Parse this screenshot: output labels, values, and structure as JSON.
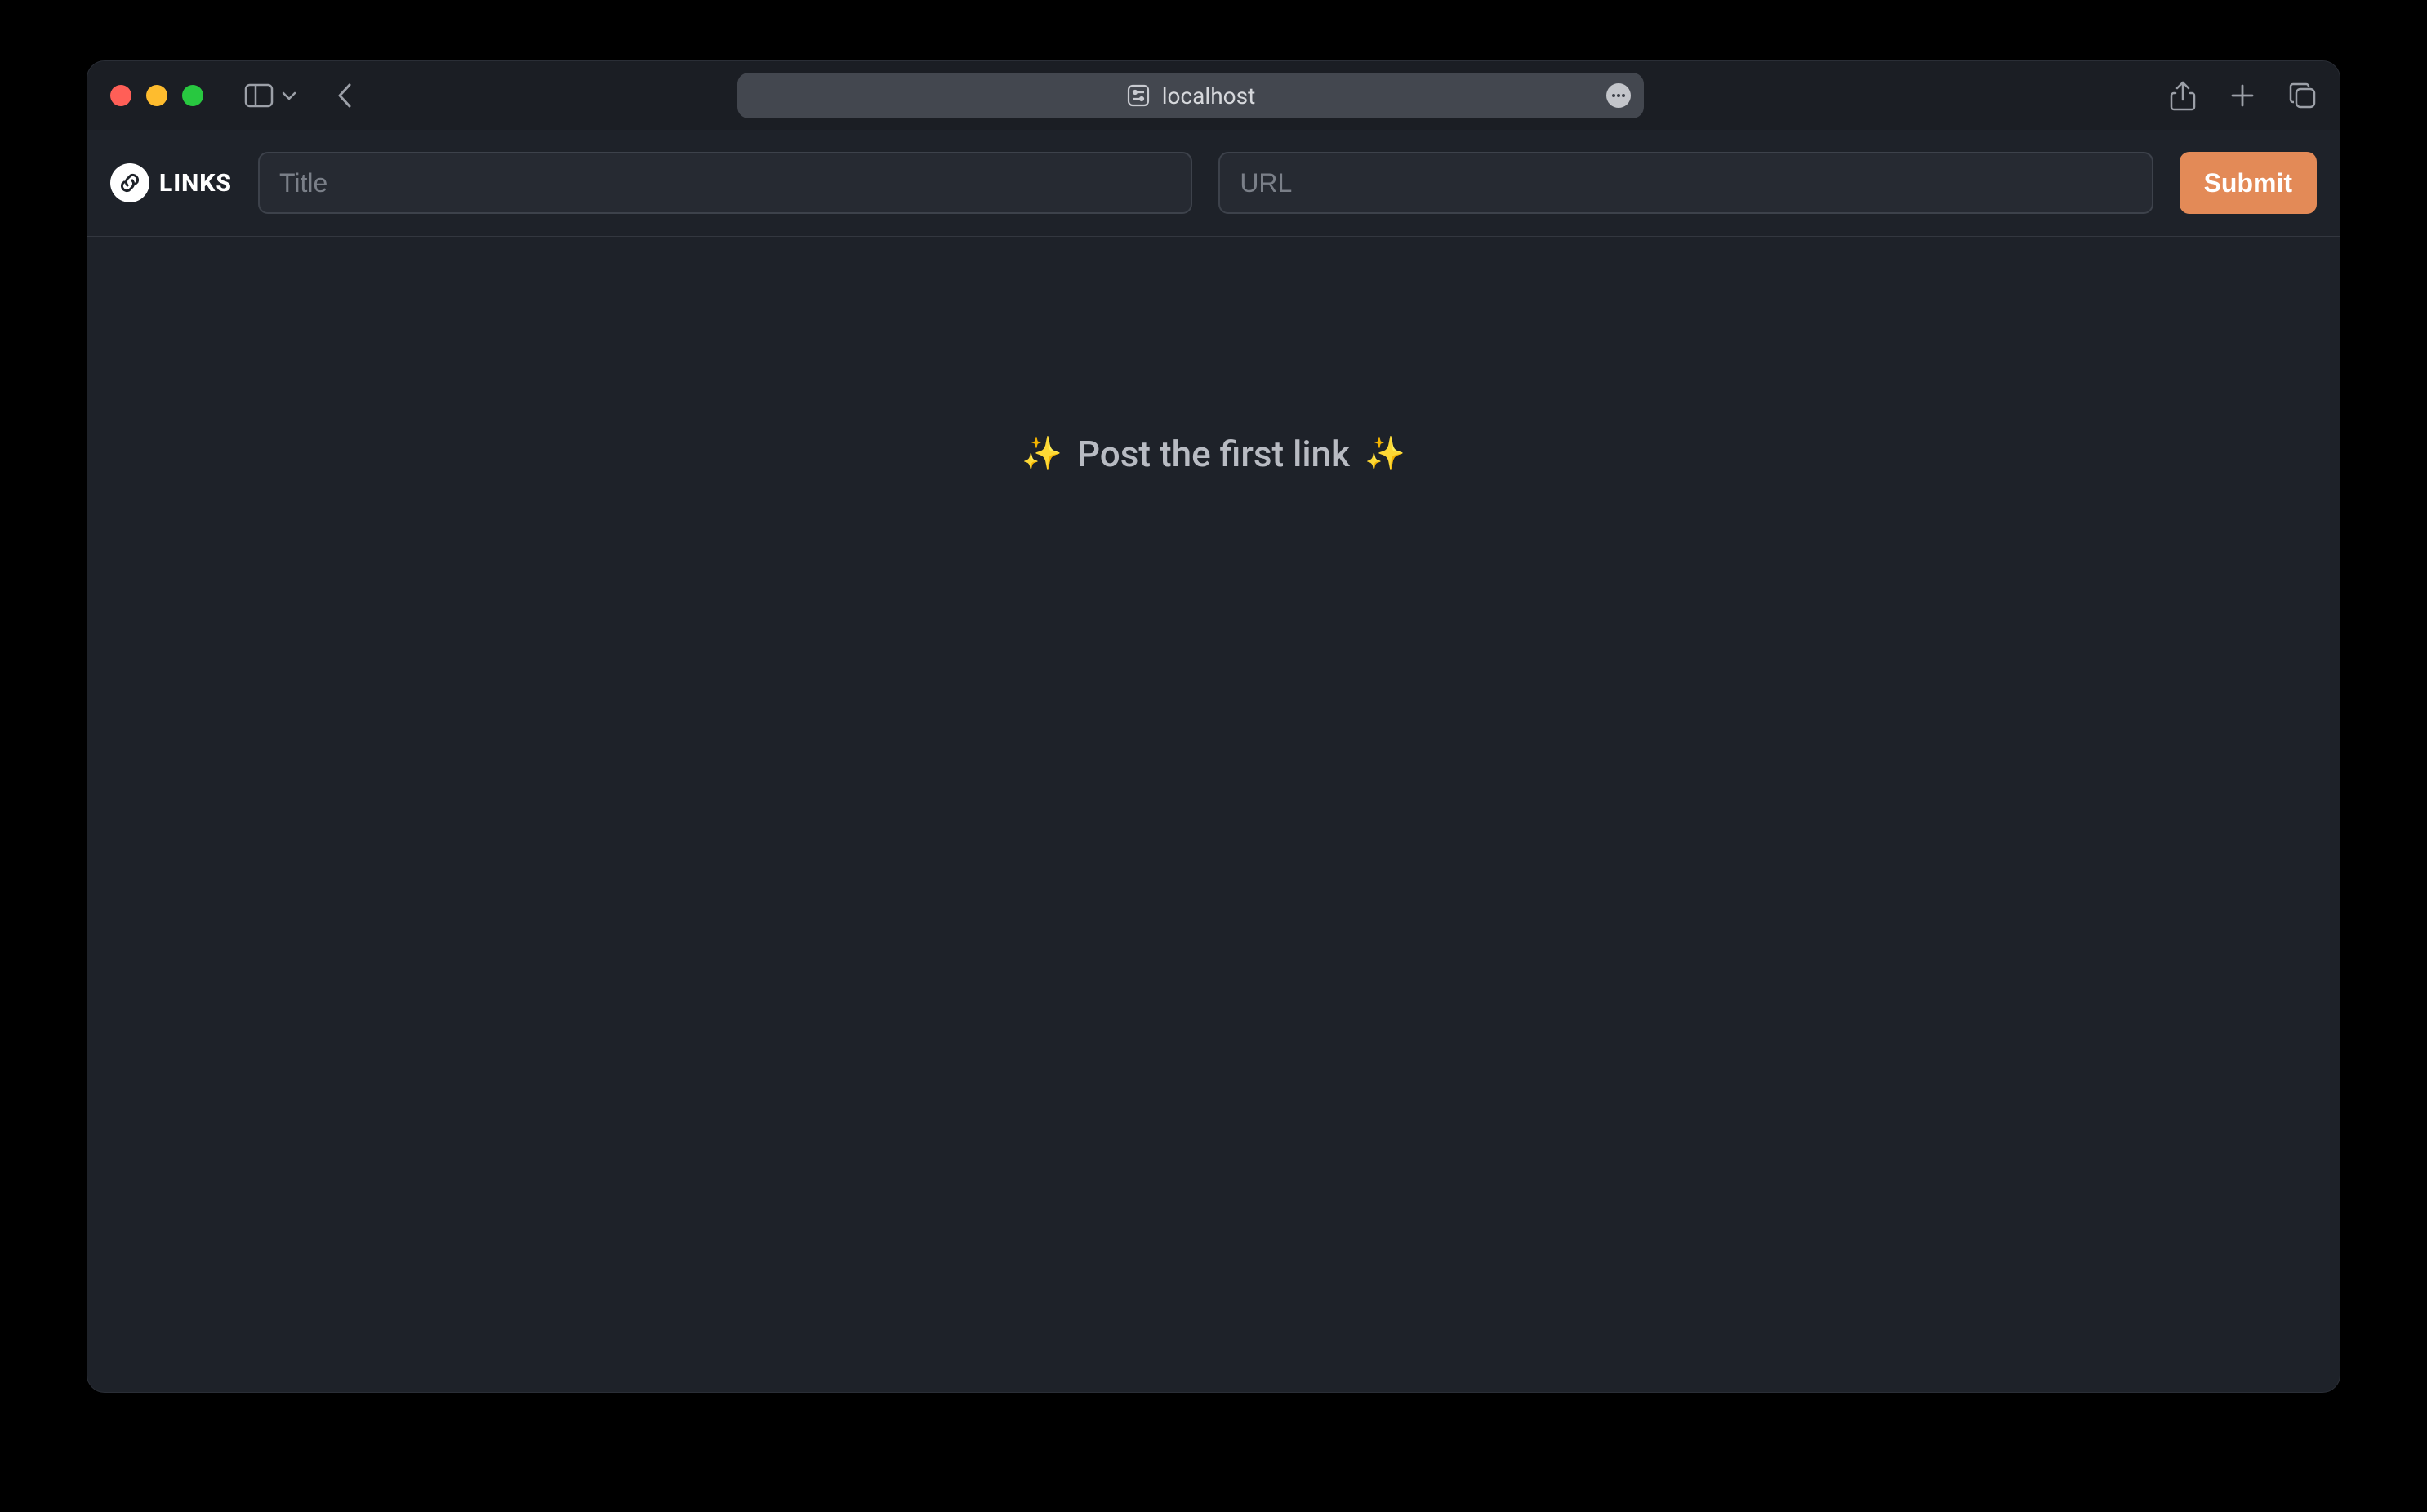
{
  "browser": {
    "address": "localhost"
  },
  "app": {
    "brand_label": "LINKS",
    "title_placeholder": "Title",
    "url_placeholder": "URL",
    "submit_label": "Submit",
    "empty_state": {
      "leading_emoji": "✨",
      "text": "Post the first link",
      "trailing_emoji": "✨"
    }
  }
}
